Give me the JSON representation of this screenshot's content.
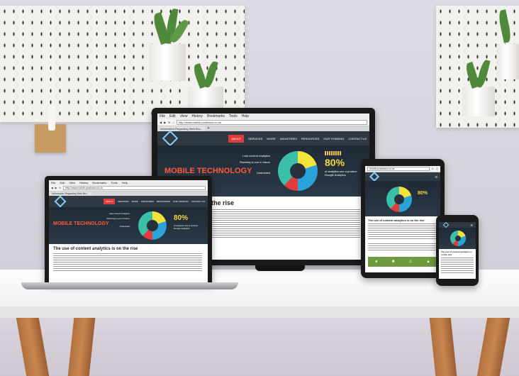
{
  "monitor": {
    "menu": [
      "File",
      "Edit",
      "View",
      "History",
      "Bookmarks",
      "Tools",
      "Help"
    ],
    "url": "http://www.mobile.pcadvisor.co.uk",
    "tab_title": "Information Regarding Web Bro...",
    "nav": [
      "ABOUT",
      "SERVICES",
      "WORK",
      "INDUSTRIES",
      "RESOURCES",
      "OUR THINKING",
      "CONTACT US"
    ],
    "hero_title": "MOBILE TECHNOLOGY",
    "hero_labels": [
      "Last content Analytics",
      "Planning to use in future",
      "Undecided"
    ],
    "stat_value": "80%",
    "stat_text": "of analytics see a product Google Analytics",
    "headline": "t analytics is on the rise"
  },
  "laptop": {
    "menu": [
      "File",
      "Edit",
      "View",
      "History",
      "Bookmarks",
      "Tools",
      "Help"
    ],
    "url": "http://www.mobile.pcadvisor.co.uk",
    "tab_title": "Information Regarding Web Bro...",
    "nav": [
      "ABOUT",
      "SERVICES",
      "WORK",
      "INDUSTRIES",
      "RESOURCES",
      "OUR THINKING",
      "CONTACT US"
    ],
    "hero_title": "MOBILE TECHNOLOGY",
    "hero_labels": [
      "Last content Analytics",
      "Planning to use in future",
      "Undecided"
    ],
    "stat_value": "80%",
    "stat_text": "of analytics see a product Google Analytics",
    "headline": "The use of content analytics is on the rise"
  },
  "tablet": {
    "url": "mobile.pcadvisor.co.uk",
    "headline": "The use of content analytics is on the rise"
  },
  "phone": {
    "headline": "The use of content analytics is on the rise"
  },
  "colors": {
    "site_nav": "#2e3944",
    "accent_red": "#e23b3b",
    "hero_title": "#ff5a3c",
    "donut_teal": "#3bbfa8",
    "donut_blue": "#2aa3d8",
    "donut_yellow": "#f5e33c"
  }
}
